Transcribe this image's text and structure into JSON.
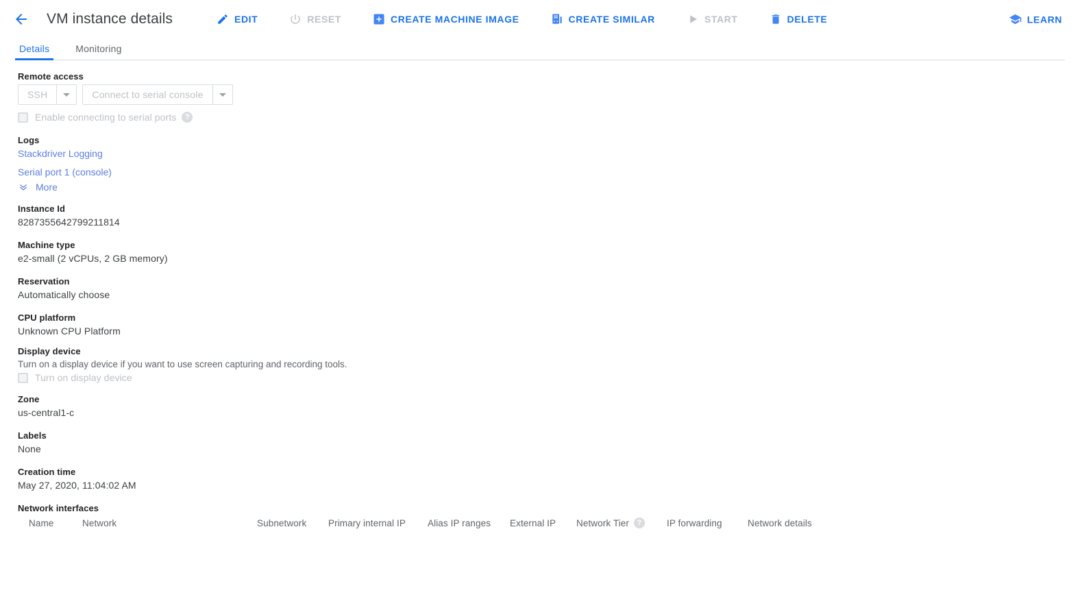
{
  "header": {
    "back_icon": "arrow-back-icon",
    "title": "VM instance details",
    "actions": [
      {
        "id": "edit",
        "label": "EDIT",
        "icon": "pencil-icon",
        "disabled": false
      },
      {
        "id": "reset",
        "label": "RESET",
        "icon": "power-reset-icon",
        "disabled": true
      },
      {
        "id": "create-machine-image",
        "label": "CREATE MACHINE IMAGE",
        "icon": "plus-square-icon",
        "disabled": false
      },
      {
        "id": "create-similar",
        "label": "CREATE SIMILAR",
        "icon": "copy-instance-icon",
        "disabled": false
      },
      {
        "id": "start",
        "label": "START",
        "icon": "play-icon",
        "disabled": true
      },
      {
        "id": "delete",
        "label": "DELETE",
        "icon": "trash-icon",
        "disabled": false
      }
    ],
    "learn": {
      "label": "LEARN",
      "icon": "graduation-cap-icon"
    }
  },
  "tabs": [
    {
      "id": "details",
      "label": "Details",
      "active": true
    },
    {
      "id": "monitoring",
      "label": "Monitoring",
      "active": false
    }
  ],
  "remote_access": {
    "label": "Remote access",
    "ssh_button": "SSH",
    "serial_console_button": "Connect to serial console",
    "serial_ports_checkbox_label": "Enable connecting to serial ports",
    "help_icon": "help-icon",
    "checkbox_checked": false
  },
  "logs": {
    "label": "Logs",
    "links": [
      "Stackdriver Logging",
      "Serial port 1 (console)"
    ],
    "more_label": "More",
    "more_icon": "double-chevron-down-icon"
  },
  "instance_id": {
    "label": "Instance Id",
    "value": "8287355642799211814"
  },
  "machine_type": {
    "label": "Machine type",
    "value": "e2-small (2 vCPUs, 2 GB memory)"
  },
  "reservation": {
    "label": "Reservation",
    "value": "Automatically choose"
  },
  "cpu_platform": {
    "label": "CPU platform",
    "value": "Unknown CPU Platform"
  },
  "display_device": {
    "label": "Display device",
    "description": "Turn on a display device if you want to use screen capturing and recording tools.",
    "checkbox_label": "Turn on display device",
    "checkbox_checked": false
  },
  "zone": {
    "label": "Zone",
    "value": "us-central1-c"
  },
  "labels": {
    "label": "Labels",
    "value": "None"
  },
  "creation_time": {
    "label": "Creation time",
    "value": "May 27, 2020, 11:04:02 AM"
  },
  "network_interfaces": {
    "label": "Network interfaces",
    "columns": [
      "Name",
      "Network",
      "Subnetwork",
      "Primary internal IP",
      "Alias IP ranges",
      "External IP",
      "Network Tier",
      "IP forwarding",
      "Network details"
    ],
    "tier_help_icon": "help-icon"
  },
  "colors": {
    "accent_blue": "#1a73e8",
    "link_blue": "#5b7fdb",
    "disabled_gray": "#bdc1c6",
    "text_primary": "#202124",
    "text_secondary": "#5f6368",
    "border": "#dadce0"
  }
}
